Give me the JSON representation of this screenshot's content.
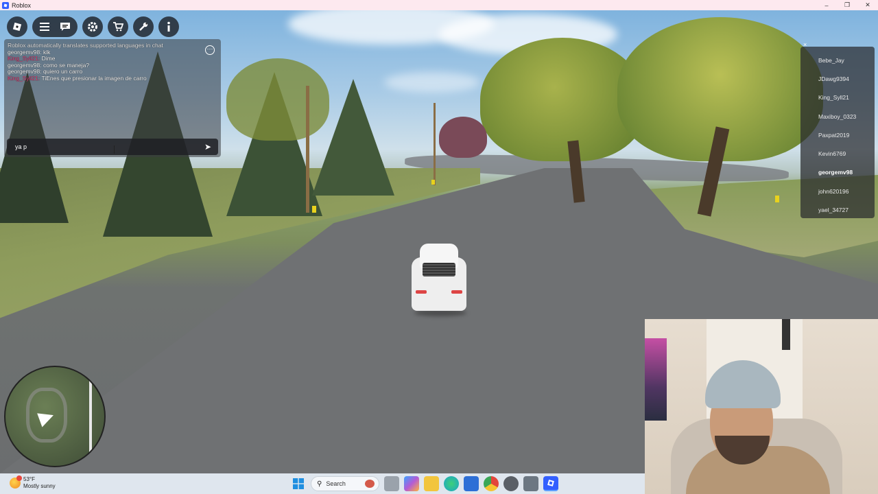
{
  "window": {
    "title": "Roblox",
    "buttons": {
      "minimize": "–",
      "maximize": "❐",
      "close": "✕"
    }
  },
  "topbar": {
    "icons": [
      "roblox-logo-icon",
      "menu-icon",
      "chat-icon",
      "settings-icon",
      "cart-icon",
      "tools-icon",
      "info-icon"
    ]
  },
  "chat": {
    "messages": [
      {
        "name": "",
        "text": "Roblox automatically translates supported languages in chat",
        "type": "system"
      },
      {
        "name": "georgemv98:",
        "text": "klk",
        "type": "user1"
      },
      {
        "name": "King_Syll21:",
        "text": "Dime",
        "type": "user2"
      },
      {
        "name": "georgemv98:",
        "text": "como se maneja?",
        "type": "user1"
      },
      {
        "name": "georgemv98:",
        "text": "quiero un carro",
        "type": "user1"
      },
      {
        "name": "King_Syll21:",
        "text": "TiEnes que presionar la imagen de carro",
        "type": "user2"
      }
    ],
    "input_value": "ya p",
    "more_label": "···",
    "send_label": "➤"
  },
  "playerlist": {
    "close_label": "×",
    "players": [
      "Bebe_Jay",
      "JDawg9394",
      "King_Syll21",
      "Maxiboy_0323",
      "Paxpat2019",
      "Kevin6769",
      "georgemv98",
      "john620196",
      "yael_34727"
    ],
    "current_player": "georgemv98"
  },
  "taskbar": {
    "weather_temp": "53°F",
    "weather_desc": "Mostly sunny",
    "search_label": "Search",
    "colors": {
      "windows_start": "#1f8fe0",
      "edge": "#1aa4c9",
      "chrome": "#e2453c",
      "roblox": "#335fff"
    }
  }
}
